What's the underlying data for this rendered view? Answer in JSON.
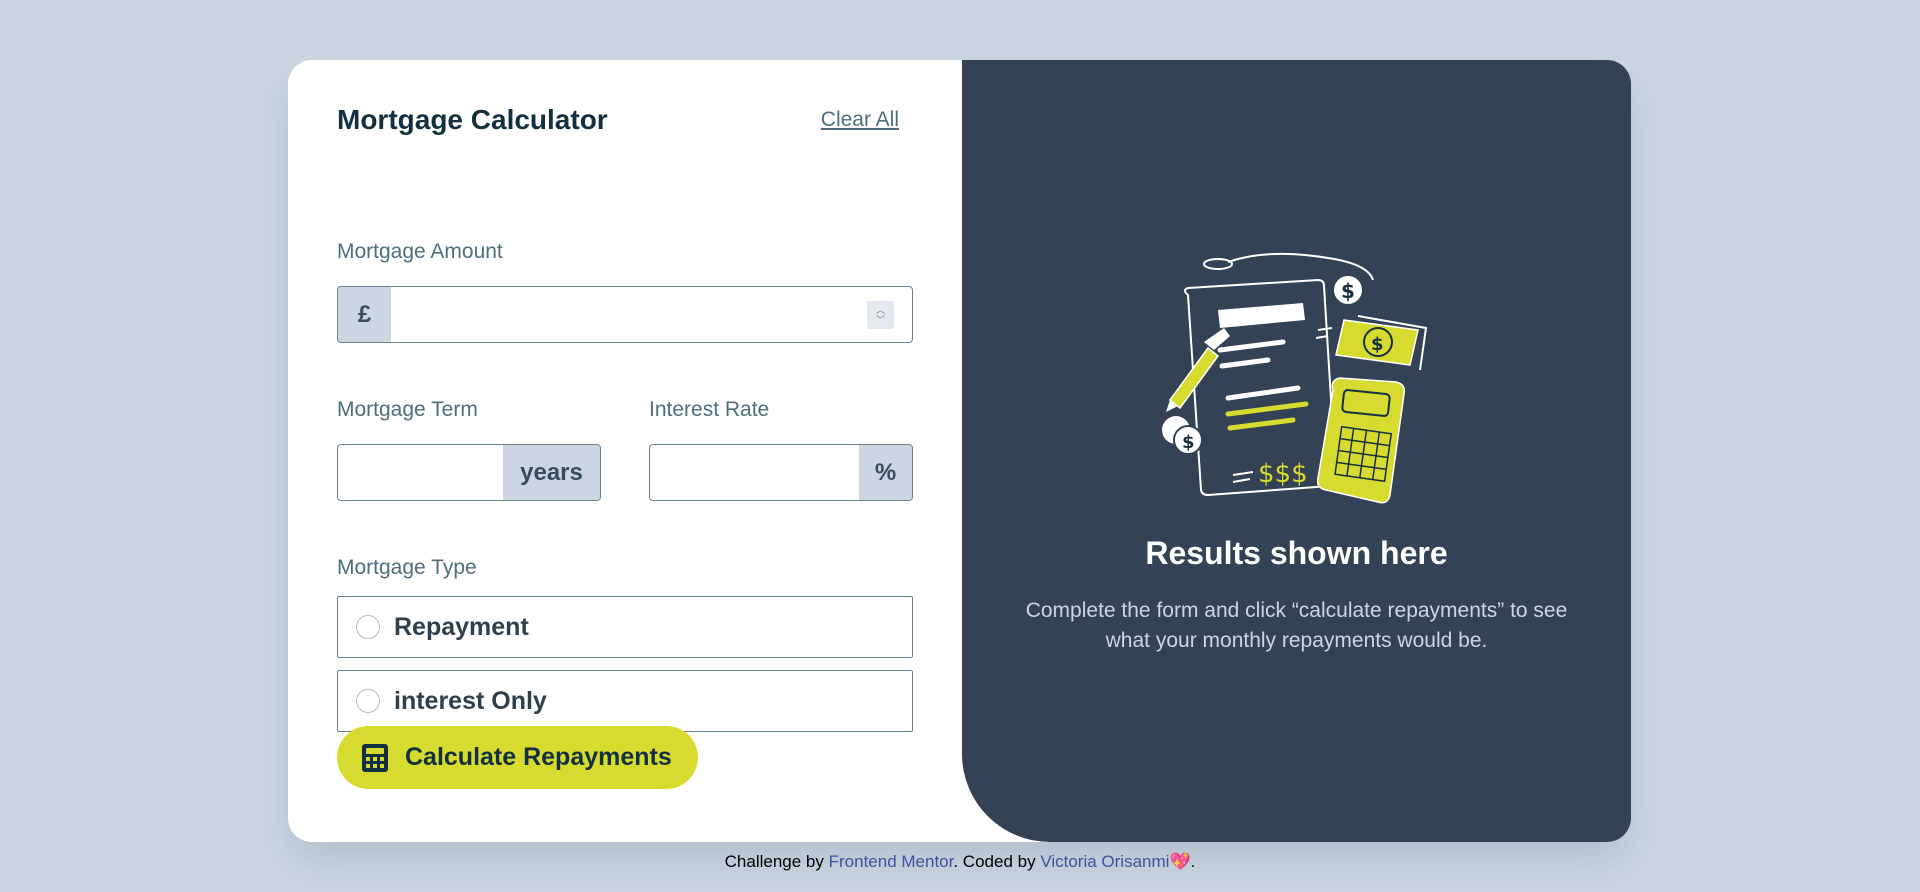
{
  "form": {
    "title": "Mortgage Calculator",
    "clear_all": "Clear All",
    "amount": {
      "label": "Mortgage Amount",
      "prefix": "£",
      "value": ""
    },
    "term": {
      "label": "Mortgage Term",
      "suffix": "years",
      "value": ""
    },
    "rate": {
      "label": "Interest Rate",
      "suffix": "%",
      "value": ""
    },
    "type": {
      "label": "Mortgage Type",
      "options": [
        {
          "label": "Repayment",
          "selected": false
        },
        {
          "label": "interest Only",
          "selected": false
        }
      ]
    },
    "submit_label": "Calculate Repayments"
  },
  "results": {
    "title": "Results shown here",
    "text": "Complete the form and click “calculate repayments” to see what your monthly repayments would be."
  },
  "footer": {
    "prefix": "Challenge by ",
    "link1": "Frontend Mentor",
    "middle": ". Coded by ",
    "link2": "Victoria Orisanmi",
    "suffix": "."
  },
  "colors": {
    "accent": "#d8db2f",
    "dark": "#133041",
    "results_bg": "#334254",
    "page_bg": "#cbd6e1"
  },
  "icons": [
    "calculator-icon",
    "heart-icon",
    "empty-results-illustration"
  ]
}
